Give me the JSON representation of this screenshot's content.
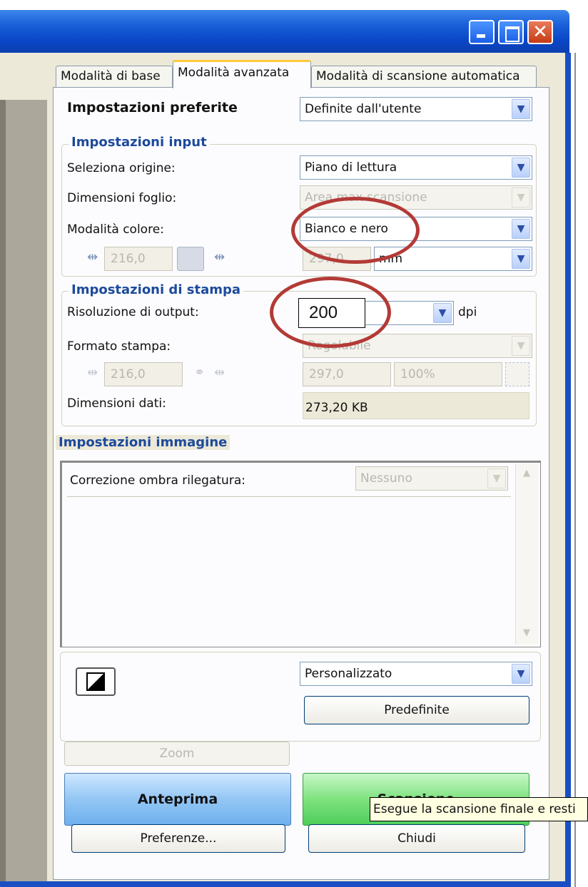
{
  "window": {
    "minimize_icon": "minimize-icon",
    "maximize_icon": "maximize-icon",
    "close_icon": "close-icon",
    "close_glyph": "✕"
  },
  "tabs": [
    {
      "label": "Modalità di base"
    },
    {
      "label": "Modalità avanzata"
    },
    {
      "label": "Modalità di scansione automatica"
    }
  ],
  "preferred": {
    "label": "Impostazioni preferite",
    "value": "Definite dall'utente"
  },
  "input_settings": {
    "title": "Impostazioni input",
    "source_label": "Seleziona origine:",
    "source_value": "Piano di lettura",
    "sheet_label": "Dimensioni foglio:",
    "sheet_value": "Area max scansione",
    "color_label": "Modalità colore:",
    "color_value": "Bianco e nero",
    "width": "216,0",
    "height": "297,0",
    "unit": "mm"
  },
  "print_settings": {
    "title": "Impostazioni di stampa",
    "resolution_label": "Risoluzione di output:",
    "resolution_value": "200",
    "dpi_label": "dpi",
    "format_label": "Formato stampa:",
    "format_value": "Regolabile",
    "width": "216,0",
    "height": "297,0",
    "scale": "100%",
    "data_size_label": "Dimensioni dati:",
    "data_size_value": "273,20 KB"
  },
  "image_settings": {
    "title": "Impostazioni immagine",
    "binding_label": "Correzione ombra rilegatura:",
    "binding_value": "Nessuno"
  },
  "tone": {
    "preset_value": "Personalizzato",
    "defaults_button": "Predefinite"
  },
  "actions": {
    "zoom": "Zoom",
    "preview": "Anteprima",
    "scan": "Scansione",
    "preferences": "Preferenze...",
    "close": "Chiudi"
  },
  "tooltip": "Esegue la scansione finale e resti",
  "colors": {
    "title_bar": "#0a47c8",
    "group_title": "#1c4a9c",
    "annotation": "#b33a36",
    "preview_button": "#93c6f4",
    "scan_button": "#7ee27e"
  }
}
